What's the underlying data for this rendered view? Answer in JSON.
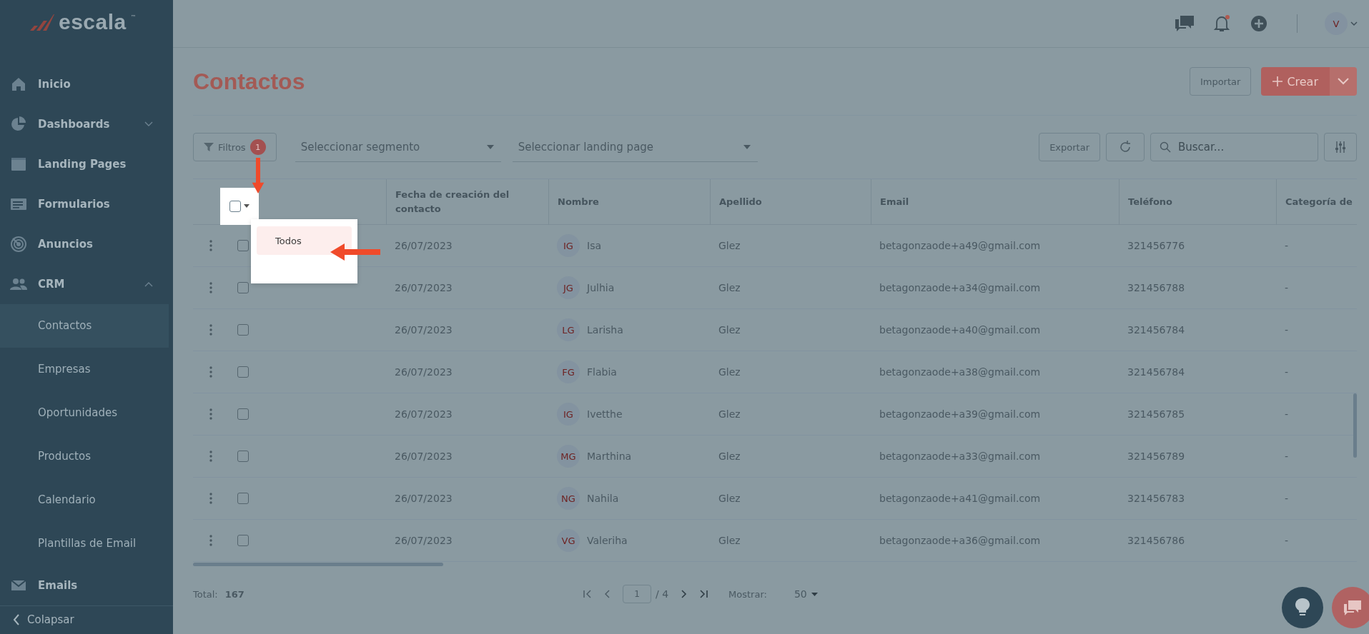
{
  "sidebar": {
    "logo": "escala",
    "logo_mark": "™",
    "items": [
      {
        "label": "Inicio"
      },
      {
        "label": "Dashboards",
        "expanded": false
      },
      {
        "label": "Landing Pages"
      },
      {
        "label": "Formularios"
      },
      {
        "label": "Anuncios"
      },
      {
        "label": "CRM",
        "expanded": true,
        "children": [
          {
            "label": "Contactos",
            "selected": true
          },
          {
            "label": "Empresas",
            "selected": false
          },
          {
            "label": "Oportunidades",
            "selected": false
          },
          {
            "label": "Productos",
            "selected": false
          },
          {
            "label": "Calendario",
            "selected": false
          },
          {
            "label": "Plantillas de Email",
            "selected": false
          }
        ]
      },
      {
        "label": "Emails"
      }
    ],
    "collapse": "Colapsar"
  },
  "header": {
    "avatar": "V",
    "notification": true
  },
  "page": {
    "title": "Contactos",
    "import_button": "Importar",
    "create_button": "Crear"
  },
  "toolbar": {
    "filter_button": "Filtros",
    "filter_count": "1",
    "segment_select": "Seleccionar segmento",
    "landing_select": "Seleccionar landing page",
    "export_button": "Exportar",
    "search": {
      "placeholder": "Buscar..."
    }
  },
  "table": {
    "select_all": {
      "checked": false
    },
    "select_menu": {
      "items": [
        "Todos"
      ]
    },
    "columns": [
      "Fecha de creación del contacto",
      "Nombre",
      "Apellido",
      "Email",
      "Teléfono",
      "Categoría de"
    ],
    "rows": [
      {
        "checked": false,
        "date": "26/07/2023",
        "initials": "IG",
        "name": "Isa",
        "surname": "Glez",
        "email": "betagonzaode+a49@gmail.com",
        "phone": "321456776",
        "category": "-"
      },
      {
        "checked": false,
        "date": "26/07/2023",
        "initials": "JG",
        "name": "Julhia",
        "surname": "Glez",
        "email": "betagonzaode+a34@gmail.com",
        "phone": "321456788",
        "category": "-"
      },
      {
        "checked": false,
        "date": "26/07/2023",
        "initials": "LG",
        "name": "Larisha",
        "surname": "Glez",
        "email": "betagonzaode+a40@gmail.com",
        "phone": "321456784",
        "category": "-"
      },
      {
        "checked": false,
        "date": "26/07/2023",
        "initials": "FG",
        "name": "Flabia",
        "surname": "Glez",
        "email": "betagonzaode+a38@gmail.com",
        "phone": "321456784",
        "category": "-"
      },
      {
        "checked": false,
        "date": "26/07/2023",
        "initials": "IG",
        "name": "Ivetthe",
        "surname": "Glez",
        "email": "betagonzaode+a39@gmail.com",
        "phone": "321456785",
        "category": "-"
      },
      {
        "checked": false,
        "date": "26/07/2023",
        "initials": "MG",
        "name": "Marthina",
        "surname": "Glez",
        "email": "betagonzaode+a33@gmail.com",
        "phone": "321456789",
        "category": "-"
      },
      {
        "checked": false,
        "date": "26/07/2023",
        "initials": "NG",
        "name": "Nahila",
        "surname": "Glez",
        "email": "betagonzaode+a41@gmail.com",
        "phone": "321456783",
        "category": "-"
      },
      {
        "checked": false,
        "date": "26/07/2023",
        "initials": "VG",
        "name": "Valeriha",
        "surname": "Glez",
        "email": "betagonzaode+a36@gmail.com",
        "phone": "321456786",
        "category": "-"
      }
    ]
  },
  "footer": {
    "total_label": "Total:",
    "total": "167",
    "page": "1",
    "pages": "/ 4",
    "show_label": "Mostrar:",
    "page_size": "50"
  }
}
